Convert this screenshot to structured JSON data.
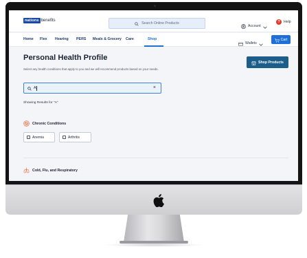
{
  "brand": {
    "logo_box": "nations",
    "logo_rest": "benefits"
  },
  "header": {
    "search_placeholder": "Search Online Products",
    "account_label": "Account",
    "help_label": "Help",
    "help_badge": "?"
  },
  "nav": {
    "items": [
      "Home",
      "Flex",
      "Hearing",
      "PERS",
      "Meals & Grocery",
      "Care",
      "Shop"
    ],
    "active": "Shop",
    "wallets_label": "Wallets",
    "cart_label": "Cart"
  },
  "page": {
    "title": "Personal Health Profile",
    "subtitle": "Select any health conditions that apply to you and we will recommend products based on your needs.",
    "shop_products_label": "Shop Products",
    "search_value": "A",
    "clear_glyph": "×",
    "results_text": "Showing Results for \"A\""
  },
  "sections": [
    {
      "label": "Chronic Conditions",
      "icon": "heart-rate-icon",
      "chips": [
        "Anemia",
        "Arthritis"
      ]
    },
    {
      "label": "Cold, Flu, and Respiratory",
      "icon": "lungs-icon",
      "chips": []
    }
  ],
  "colors": {
    "accent": "#1e6fd9",
    "shop_products_button": "#1d5d8a",
    "help_badge": "#e23b2a",
    "section_icon": "#e8734a"
  }
}
